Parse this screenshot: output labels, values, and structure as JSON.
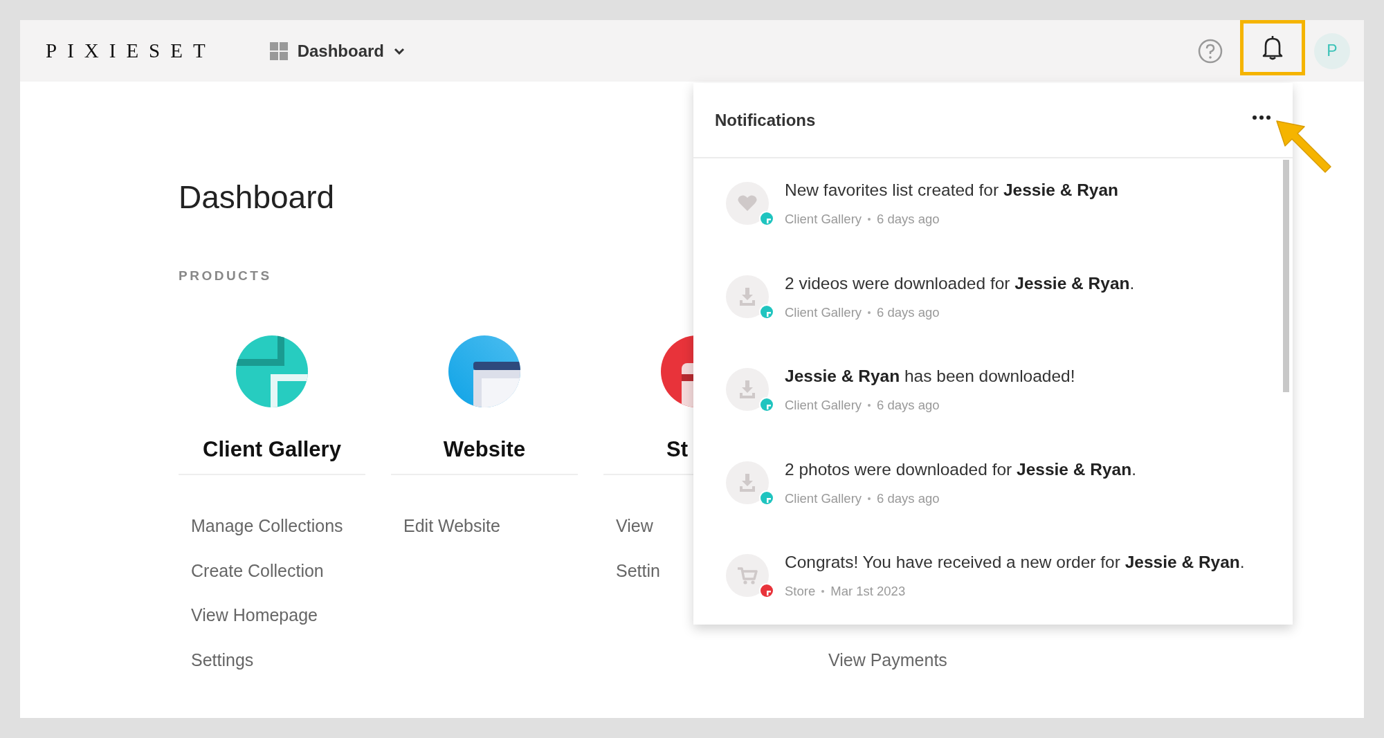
{
  "topbar": {
    "logo": "PIXIESET",
    "nav": {
      "label": "Dashboard"
    },
    "avatar": "P"
  },
  "page": {
    "title": "Dashboard",
    "section_label": "PRODUCTS"
  },
  "products": [
    {
      "kind": "gallery",
      "name": "Client Gallery",
      "links": [
        "Manage Collections",
        "Create Collection",
        "View Homepage",
        "Settings"
      ]
    },
    {
      "kind": "website",
      "name": "Website",
      "links": [
        "Edit Website"
      ]
    },
    {
      "kind": "store",
      "name": "St",
      "links": [
        "View",
        "Settin"
      ]
    },
    {
      "kind": "covered",
      "links": [
        "View Payments"
      ]
    }
  ],
  "notifications": {
    "title": "Notifications",
    "items": [
      {
        "kind": "heart",
        "message": "New favorites list created for **Jessie & Ryan**",
        "source": "Client Gallery",
        "time": "6 days ago",
        "color": "#1fc4bf"
      },
      {
        "kind": "download",
        "message": "2 videos were downloaded for **Jessie & Ryan**.",
        "source": "Client Gallery",
        "time": "6 days ago",
        "color": "#1fc4bf"
      },
      {
        "kind": "download",
        "message": "**Jessie & Ryan** has been downloaded!",
        "source": "Client Gallery",
        "time": "6 days ago",
        "color": "#1fc4bf"
      },
      {
        "kind": "download",
        "message": "2 photos were downloaded for **Jessie & Ryan**.",
        "source": "Client Gallery",
        "time": "6 days ago",
        "color": "#1fc4bf"
      },
      {
        "kind": "cart",
        "message": "Congrats! You have received a new order for **Jessie & Ryan**.",
        "source": "Store",
        "time": "Mar 1st 2023",
        "color": "#e8333a"
      }
    ]
  }
}
